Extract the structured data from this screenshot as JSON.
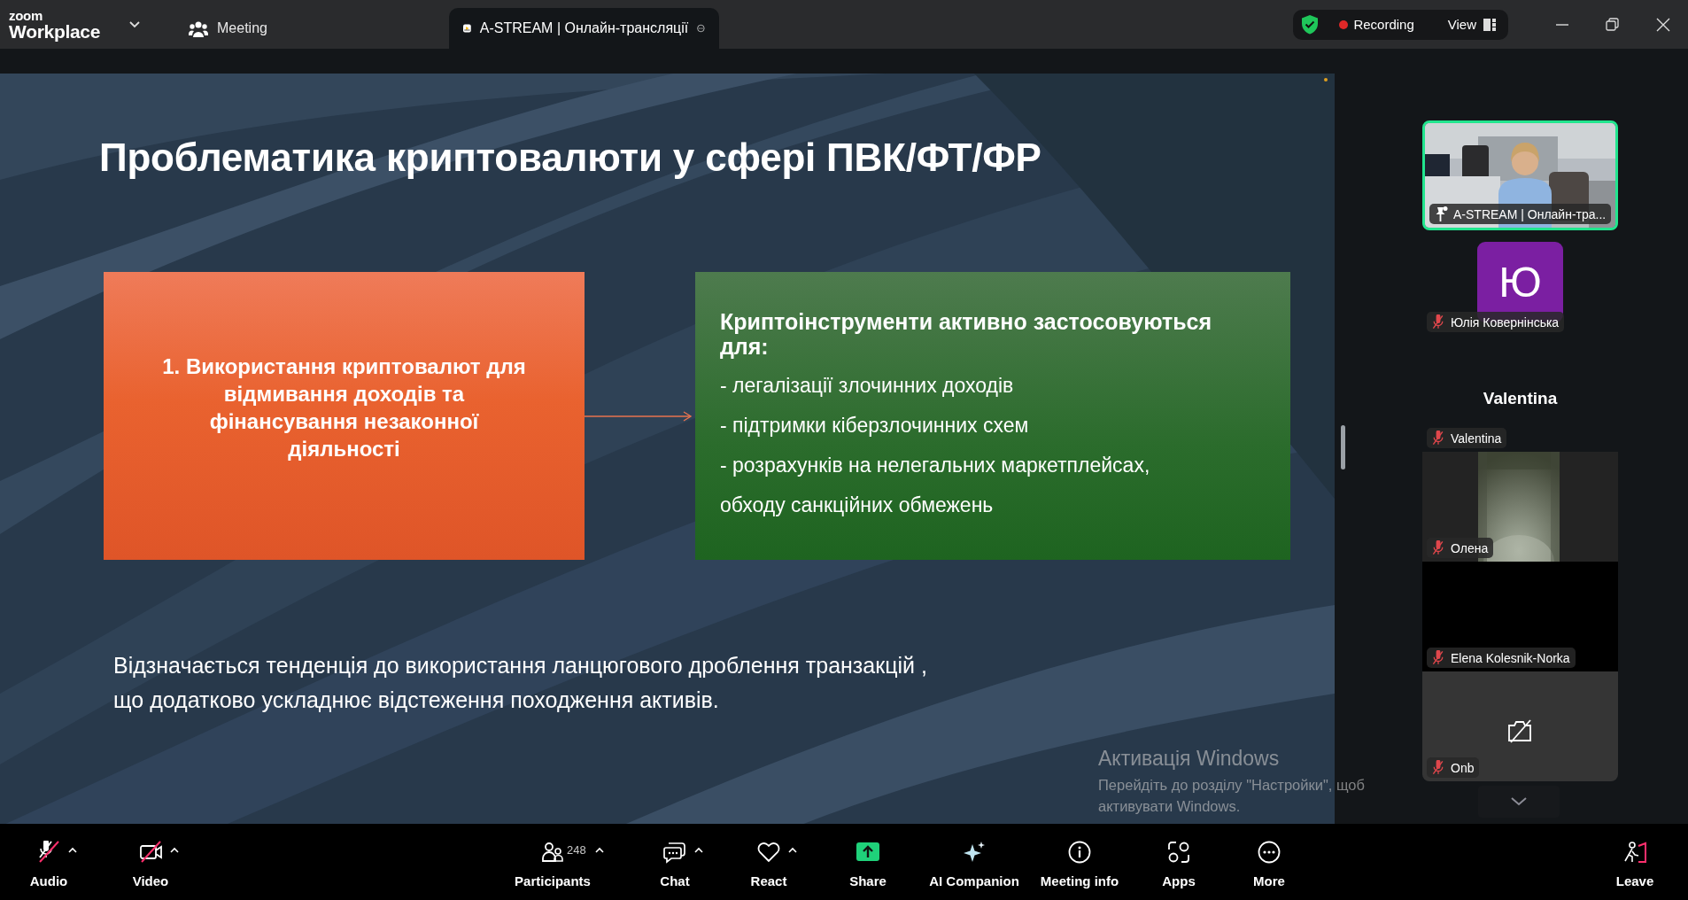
{
  "titlebar": {
    "brand_top": "zoom",
    "brand_bottom": "Workplace",
    "tabs": [
      {
        "label": "Meeting",
        "kind": "meeting",
        "selected": false
      },
      {
        "label": "A-STREAM | Онлайн-трансляції",
        "kind": "stream",
        "selected": true
      }
    ],
    "recording": "Recording",
    "view": "View"
  },
  "slide": {
    "title": "Проблематика криптовалюти у сфері ПВК/ФТ/ФР",
    "left_box": "1. Використання криптовалют для відмивання доходів та фінансування незаконної діяльності",
    "right_heading": "Криптоінструменти активно застосовуються для:",
    "right_lines": [
      "- легалізації злочинних доходів",
      "- підтримки кіберзлочинних схем",
      "- розрахунків на нелегальних маркетплейсах,",
      "обходу санкційних обмежень"
    ],
    "note_lines": [
      "Відзначається тенденція до використання ланцюгового дроблення транзакцій ,",
      "що додатково ускладнює відстеження походження активів."
    ]
  },
  "participants": [
    {
      "kind": "video",
      "name": "A-STREAM | Онлайн-тра...",
      "pinned": true,
      "muted": false,
      "speaking": true
    },
    {
      "kind": "avatar",
      "initial": "Ю",
      "color": "#7b1fa2",
      "name": "Юлія Ковернінська",
      "pinned": false,
      "muted": true,
      "speaking": false
    },
    {
      "kind": "name",
      "display": "Valentina",
      "name": "Valentina",
      "pinned": false,
      "muted": true,
      "speaking": false
    },
    {
      "kind": "camera",
      "name": "Олена",
      "pinned": false,
      "muted": true,
      "speaking": false
    },
    {
      "kind": "blank",
      "name": "Elena Kolesnik-Norka",
      "pinned": false,
      "muted": true,
      "speaking": false
    },
    {
      "kind": "camera_off",
      "name": "Onb",
      "pinned": false,
      "muted": true,
      "speaking": false
    }
  ],
  "toolbar": [
    {
      "kind": "audio",
      "label": "Audio",
      "off": true,
      "caret": true
    },
    {
      "kind": "video",
      "label": "Video",
      "off": true,
      "caret": true
    },
    {
      "kind": "participants",
      "label": "Participants",
      "count": "248",
      "caret": true
    },
    {
      "kind": "chat",
      "label": "Chat",
      "caret": true
    },
    {
      "kind": "react",
      "label": "React",
      "caret": true
    },
    {
      "kind": "share",
      "label": "Share",
      "caret": false
    },
    {
      "kind": "ai",
      "label": "AI Companion",
      "caret": false
    },
    {
      "kind": "info",
      "label": "Meeting info",
      "caret": false
    },
    {
      "kind": "apps",
      "label": "Apps",
      "caret": false
    },
    {
      "kind": "more",
      "label": "More",
      "caret": false
    },
    {
      "kind": "leave",
      "label": "Leave",
      "caret": false
    }
  ],
  "windows_notice": {
    "title": "Активація Windows",
    "text": "Перейдіть до розділу \"Настройки\", щоб активувати Windows."
  }
}
